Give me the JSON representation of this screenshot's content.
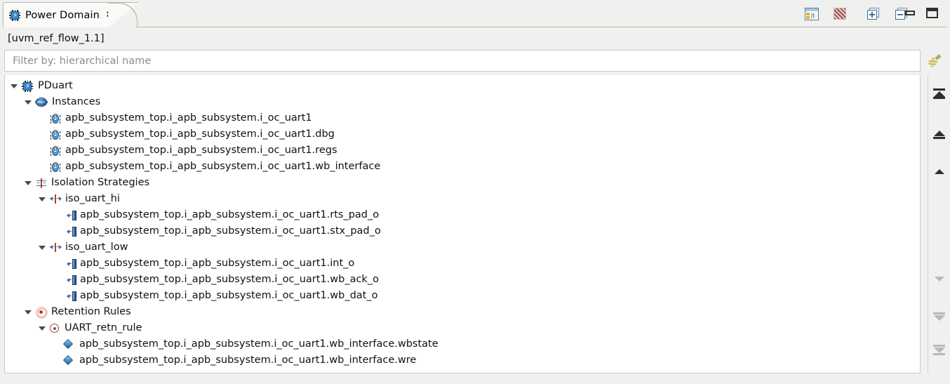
{
  "window": {
    "tab": {
      "label": "Power Domain",
      "close_glyph": "✖",
      "icon": "power-domain-chip-icon"
    },
    "minimize_label": "Minimize",
    "maximize_label": "Maximize"
  },
  "toolbar": {
    "items": [
      {
        "name": "show-properties-icon",
        "title": "Show Properties"
      },
      {
        "name": "grid-view-icon",
        "title": "Grid View"
      },
      {
        "name": "expand-all-icon",
        "title": "Expand All",
        "glyph": "+"
      },
      {
        "name": "collapse-all-icon",
        "title": "Collapse All",
        "glyph": "−"
      }
    ]
  },
  "breadcrumb": {
    "text": "[uvm_ref_flow_1.1]"
  },
  "filter": {
    "placeholder": "Filter by: hierarchical name",
    "value": "",
    "clear_icon": "brush-clear-icon"
  },
  "tree": {
    "nodes": [
      {
        "label": "PDuart",
        "icon": "chip-icon",
        "depth": 0,
        "expanded": true,
        "kind": "domain"
      },
      {
        "label": "Instances",
        "icon": "sphere-icon",
        "depth": 1,
        "expanded": true,
        "kind": "group"
      },
      {
        "label": "apb_subsystem_top.i_apb_subsystem.i_oc_uart1",
        "icon": "module-icon",
        "depth": 2,
        "kind": "instance"
      },
      {
        "label": "apb_subsystem_top.i_apb_subsystem.i_oc_uart1.dbg",
        "icon": "module-icon",
        "depth": 2,
        "kind": "instance"
      },
      {
        "label": "apb_subsystem_top.i_apb_subsystem.i_oc_uart1.regs",
        "icon": "module-icon",
        "depth": 2,
        "kind": "instance"
      },
      {
        "label": "apb_subsystem_top.i_apb_subsystem.i_oc_uart1.wb_interface",
        "icon": "module-icon",
        "depth": 2,
        "kind": "instance"
      },
      {
        "label": "Isolation Strategies",
        "icon": "isolation-group-icon",
        "depth": 1,
        "expanded": true,
        "kind": "group"
      },
      {
        "label": "iso_uart_hi",
        "icon": "isolation-icon",
        "depth": 2,
        "expanded": true,
        "kind": "strategy"
      },
      {
        "label": "apb_subsystem_top.i_apb_subsystem.i_oc_uart1.rts_pad_o",
        "icon": "port-icon",
        "depth": 3,
        "kind": "port"
      },
      {
        "label": "apb_subsystem_top.i_apb_subsystem.i_oc_uart1.stx_pad_o",
        "icon": "port-icon",
        "depth": 3,
        "kind": "port"
      },
      {
        "label": "iso_uart_low",
        "icon": "isolation-icon",
        "depth": 2,
        "expanded": true,
        "kind": "strategy"
      },
      {
        "label": "apb_subsystem_top.i_apb_subsystem.i_oc_uart1.int_o",
        "icon": "port-icon",
        "depth": 3,
        "kind": "port"
      },
      {
        "label": "apb_subsystem_top.i_apb_subsystem.i_oc_uart1.wb_ack_o",
        "icon": "port-icon",
        "depth": 3,
        "kind": "port"
      },
      {
        "label": "apb_subsystem_top.i_apb_subsystem.i_oc_uart1.wb_dat_o",
        "icon": "port-icon",
        "depth": 3,
        "kind": "port"
      },
      {
        "label": "Retention Rules",
        "icon": "retention-group-icon",
        "depth": 1,
        "expanded": true,
        "kind": "group"
      },
      {
        "label": "UART_retn_rule",
        "icon": "retention-rule-icon",
        "depth": 2,
        "expanded": true,
        "kind": "rule"
      },
      {
        "label": "apb_subsystem_top.i_apb_subsystem.i_oc_uart1.wb_interface.wbstate",
        "icon": "diamond-icon",
        "depth": 3,
        "kind": "signal"
      },
      {
        "label": "apb_subsystem_top.i_apb_subsystem.i_oc_uart1.wb_interface.wre",
        "icon": "diamond-icon",
        "depth": 3,
        "kind": "signal"
      }
    ]
  },
  "nav_strip": {
    "buttons": [
      {
        "name": "go-to-first-icon",
        "enabled": true
      },
      {
        "name": "go-up-fast-icon",
        "enabled": true
      },
      {
        "name": "go-up-icon",
        "enabled": true
      },
      {
        "name": "go-down-icon",
        "enabled": false
      },
      {
        "name": "go-down-fast-icon",
        "enabled": false
      },
      {
        "name": "go-to-last-icon",
        "enabled": false
      }
    ]
  },
  "colors": {
    "background": "#f0f0ee",
    "panel": "#ffffff",
    "border": "#c8c8c4",
    "accent_blue": "#2f6ca8",
    "accent_red": "#c0392b",
    "placeholder": "#8d8d8d"
  }
}
